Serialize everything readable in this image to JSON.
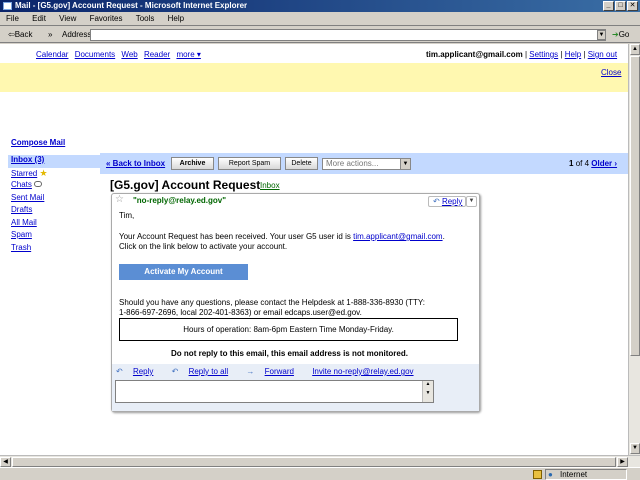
{
  "window": {
    "title": "Mail - [G5.gov] Account Request - Microsoft Internet Explorer",
    "controls": [
      "_",
      "□",
      "✕"
    ]
  },
  "menu": [
    "File",
    "Edit",
    "View",
    "Favorites",
    "Tools",
    "Help"
  ],
  "toolbar": {
    "back_label": "⇦Back",
    "chevrons": "»",
    "address_label": "Address",
    "go_label": "Go"
  },
  "topnav": {
    "links": [
      "Calendar",
      "Documents",
      "Web",
      "Reader",
      "more ▾"
    ],
    "email": "tim.applicant@gmail.com",
    "settings": "Settings",
    "help": "Help",
    "signout": "Sign out",
    "separator": "|"
  },
  "notice": {
    "close": "Close"
  },
  "sidebar": {
    "compose": "Compose Mail",
    "items": [
      {
        "label": "Inbox (3)"
      },
      {
        "label": "Starred"
      },
      {
        "label": "Chats"
      },
      {
        "label": "Sent Mail"
      },
      {
        "label": "Drafts"
      },
      {
        "label": "All Mail"
      },
      {
        "label": "Spam"
      },
      {
        "label": "Trash"
      }
    ]
  },
  "actions": {
    "back": "« Back to Inbox",
    "archive": "Archive",
    "report_spam": "Report Spam",
    "delete": "Delete",
    "more_actions": "More actions...",
    "pager_range": "1",
    "pager_of": "of 4",
    "older": "Older ›"
  },
  "message": {
    "subject": "[G5.gov] Account Request",
    "label": "Inbox",
    "sender": "\"no-reply@relay.ed.gov\"",
    "reply": "Reply",
    "greeting": "Tim,",
    "line1": "Your Account Request has been received. Your user G5 user id is",
    "user_id": "tim.applicant@gmail.com",
    "line1_end": ".",
    "line2": "Click on the link below to activate your account.",
    "activate": "Activate My Account",
    "help1": "Should you have any questions, please contact the Helpdesk at 1-888-336-8930 (TTY:",
    "help2": "1-866-697-2696, local 202-401-8363) or email edcaps.user@ed.gov.",
    "hours": "Hours of operation: 8am-6pm Eastern Time Monday-Friday.",
    "noreply": "Do not reply to this email, this email address is not monitored."
  },
  "footer": {
    "reply": "Reply",
    "reply_all": "Reply to all",
    "forward": "Forward",
    "invite": "Invite no-reply@relay.ed.gov"
  },
  "status": {
    "zone": "Internet"
  }
}
